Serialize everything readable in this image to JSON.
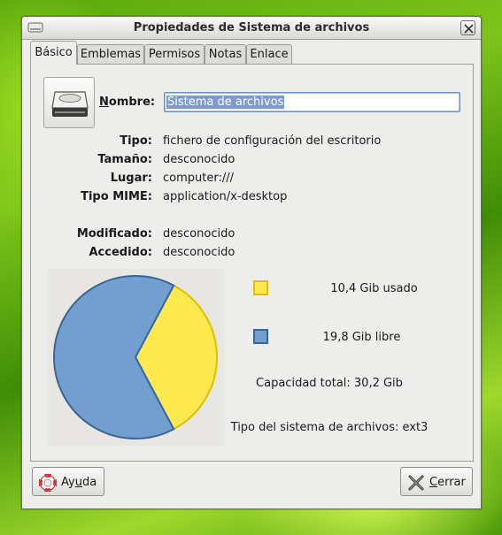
{
  "window": {
    "title": "Propiedades de Sistema de archivos"
  },
  "tabs": [
    {
      "label": "Básico",
      "active": true
    },
    {
      "label": "Emblemas",
      "active": false
    },
    {
      "label": "Permisos",
      "active": false
    },
    {
      "label": "Notas",
      "active": false
    },
    {
      "label": "Enlace",
      "active": false
    }
  ],
  "basic": {
    "icon": "harddisk-icon",
    "name_label": "Nombre:",
    "name_value": "Sistema de archivos",
    "properties": [
      {
        "label": "Tipo:",
        "value": "fichero de configuración del escritorio"
      },
      {
        "label": "Tamaño:",
        "value": "desconocido"
      },
      {
        "label": "Lugar:",
        "value": "computer:///"
      },
      {
        "label": "Tipo MIME:",
        "value": "application/x-desktop"
      },
      {
        "label": "Modificado:",
        "value": "desconocido"
      },
      {
        "label": "Accedido:",
        "value": "desconocido"
      }
    ]
  },
  "chart_data": {
    "type": "pie",
    "slices": [
      {
        "label": "10,4 Gib usado",
        "value": 10.4,
        "color": "#fde84e",
        "border": "#d8c010"
      },
      {
        "label": "19,8 Gib libre",
        "value": 19.8,
        "color": "#729fcf",
        "border": "#3a6597"
      }
    ],
    "total_label": "Capacidad total: 30,2 Gib",
    "fs_type_label": "Tipo del sistema de archivos: ext3"
  },
  "buttons": {
    "help": {
      "pre": "Ay",
      "mnemonic": "u",
      "post": "da",
      "icon": "lifebuoy-icon"
    },
    "close": {
      "pre": "",
      "mnemonic": "C",
      "post": "errar",
      "icon": "close-x-icon"
    }
  },
  "colors": {
    "selection": "#7e9cc9",
    "used": "#fde84e",
    "free": "#729fcf"
  }
}
